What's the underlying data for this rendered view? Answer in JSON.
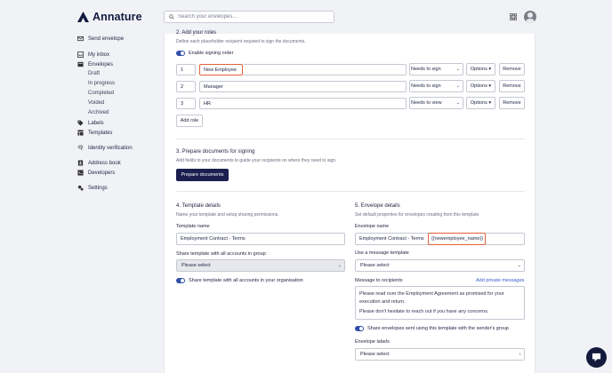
{
  "app": {
    "name": "Annature"
  },
  "search": {
    "placeholder": "Search your envelopes..."
  },
  "sidebar": {
    "send_envelope": "Send envelope",
    "my_inbox": "My inbox",
    "envelopes": "Envelopes",
    "envelope_items": [
      "Draft",
      "In progress",
      "Completed",
      "Voided",
      "Archived"
    ],
    "labels": "Labels",
    "templates": "Templates",
    "identity_verification": "Identity verification",
    "address_book": "Address book",
    "developers": "Developers",
    "settings": "Settings"
  },
  "roles_section": {
    "title": "2. Add your roles",
    "subtitle": "Define each placeholder recipient required to sign the documents.",
    "signing_order_label": "Enable signing order",
    "roles": [
      {
        "order": "1",
        "name": "New Employee",
        "action": "Needs to sign"
      },
      {
        "order": "2",
        "name": "Manager",
        "action": "Needs to sign"
      },
      {
        "order": "3",
        "name": "HR",
        "action": "Needs to view"
      }
    ],
    "options_label": "Options",
    "remove_label": "Remove",
    "add_role_label": "Add role"
  },
  "prepare_section": {
    "title": "3. Prepare documents for signing",
    "subtitle": "Add fields to your documents to guide your recipients on where they need to sign.",
    "button_label": "Prepare documents"
  },
  "template_section": {
    "title": "4. Template details",
    "subtitle": "Name your template and setup sharing permissions.",
    "name_label": "Template name",
    "name_value": "Employment Contract - Terms",
    "share_group_label": "Share template with all accounts in group:",
    "share_group_value": "Please select",
    "share_org_label": "Share template with all accounts in your organisation"
  },
  "envelope_section": {
    "title": "5. Envelope details",
    "subtitle": "Set default properties for envelopes creating from this template.",
    "name_label": "Envelope name",
    "name_value": "Employment Contract - Terms",
    "name_tag": "{{newemployee_name}}",
    "message_template_label": "Use a message template",
    "message_template_value": "Please select",
    "message_label": "Message to recipients",
    "private_messages_link": "Add private messages",
    "message_line1": "Please read over the Employment Agreement as promised for your execution and return.",
    "message_line2": "Please don't hesitate to reach out if you have any concerns.",
    "share_sender_label": "Share envelopes sent using this template with the sender's group",
    "labels_label": "Envelope labels",
    "labels_value": "Please select"
  },
  "colors": {
    "primary": "#1a1f4f",
    "accent": "#2f4fa8",
    "highlight": "#e0623a",
    "link": "#3b5bcc"
  }
}
